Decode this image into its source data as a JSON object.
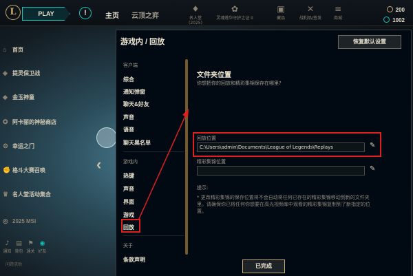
{
  "topbar": {
    "logo_text": "L",
    "play_label": "PLAY",
    "alert_icon": "exclamation-icon",
    "tabs": [
      {
        "label": "主页"
      },
      {
        "label": "云顶之弈"
      }
    ],
    "icons": [
      {
        "label": "名人堂(2025)",
        "icon": "hall-of-fame-icon"
      },
      {
        "label": "灵魂莲华守护之证 II",
        "icon": "lotus-icon"
      },
      {
        "label": "藏品",
        "icon": "collection-icon"
      },
      {
        "label": "战利品/签发",
        "icon": "loot-icon"
      },
      {
        "label": "商城",
        "icon": "store-icon"
      }
    ],
    "currency": [
      {
        "value": "200",
        "color": "#c8aa6e"
      },
      {
        "value": "1002",
        "color": "#0ac8b9"
      }
    ]
  },
  "leftnav": {
    "items": [
      {
        "label": "首页",
        "icon": "home-icon"
      },
      {
        "label": "提灵保卫战",
        "icon": "shield-icon"
      },
      {
        "label": "金玉神童",
        "icon": "gem-icon"
      },
      {
        "label": "阿卡丽的神秘商店",
        "icon": "shop-icon"
      },
      {
        "label": "幸运之门",
        "icon": "door-icon"
      },
      {
        "label": "格斗大赛召唤",
        "icon": "fist-icon"
      },
      {
        "label": "名人堂活动集合",
        "icon": "trophy-icon"
      },
      {
        "label": "2025 MSI",
        "icon": "msi-icon"
      }
    ],
    "bottom_icons": [
      {
        "label": "通知",
        "icon": "bell-icon"
      },
      {
        "label": "背包",
        "icon": "bag-icon"
      },
      {
        "label": "通关",
        "icon": "flag-icon"
      },
      {
        "label": "好友",
        "icon": "friends-icon"
      }
    ],
    "bottom_text": "问题求助"
  },
  "modal": {
    "title": "游戏内 / 回放",
    "restore_label": "恢复默认设置",
    "sidebar": {
      "client_header": "客户端",
      "client_items": [
        "综合",
        "通知弹窗",
        "聊天&好友",
        "声音",
        "语音",
        "聊天黑名单"
      ],
      "ingame_header": "游戏内",
      "ingame_items": [
        "热键",
        "声音",
        "界面",
        "游戏",
        "回放"
      ],
      "about_header": "关于",
      "about_items": [
        "条款声明"
      ]
    },
    "content": {
      "section_title": "文件夹位置",
      "section_subtitle": "你想把你的回放和精彩集锦保存在哪里?",
      "replay_label": "回放位置",
      "replay_value": "C:\\Users\\admin\\Documents\\League of Legends\\Replays",
      "highlight_label": "精彩集锦位置",
      "highlight_value": "",
      "tip_title": "提示:",
      "tip_text": "* 更改精彩集锦的保存位置将不会自动将任何已存在的精彩集锦移动到新的文件夹里。请确保你已将任何你想要在高光视频库中观看的精彩集锦复制到了新指定的位置。"
    },
    "done_label": "已完成"
  }
}
